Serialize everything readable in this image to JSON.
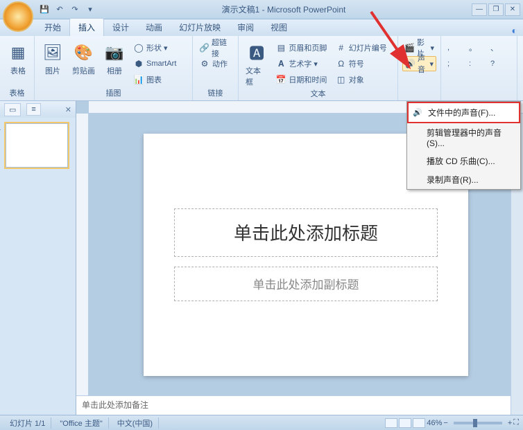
{
  "title": "演示文稿1 - Microsoft PowerPoint",
  "tabs": [
    "开始",
    "插入",
    "设计",
    "动画",
    "幻灯片放映",
    "审阅",
    "视图"
  ],
  "active_tab": 1,
  "ribbon": {
    "g_tables": {
      "label": "表格",
      "table": "表格"
    },
    "g_illust": {
      "label": "插图",
      "pic": "图片",
      "clip": "剪贴画",
      "album": "相册",
      "shapes": "形状",
      "smartart": "SmartArt",
      "chart": "图表"
    },
    "g_links": {
      "label": "链接",
      "hyper": "超链接",
      "action": "动作"
    },
    "g_text": {
      "label": "文本",
      "textbox": "文本框",
      "header": "页眉和页脚",
      "wordart": "艺术字",
      "date": "日期和时间",
      "slidenum": "幻灯片编号",
      "symbol": "符号",
      "object": "对象"
    },
    "g_media": {
      "label": "",
      "movie": "影片",
      "sound": "声音"
    },
    "g_marks": {
      "label": "",
      "m1": ",",
      "m2": "。",
      "m3": "、",
      "m4": ";",
      "m5": ":",
      "m6": "?"
    }
  },
  "dropdown": {
    "file_sound": "文件中的声音(F)...",
    "clip_sound": "剪辑管理器中的声音(S)...",
    "cd": "播放 CD 乐曲(C)...",
    "record": "录制声音(R)..."
  },
  "panel_tabs": {
    "slides_icon": "▭",
    "outline_icon": "≡"
  },
  "slide": {
    "title_ph": "单击此处添加标题",
    "sub_ph": "单击此处添加副标题"
  },
  "notes_ph": "单击此处添加备注",
  "status": {
    "slide": "幻灯片 1/1",
    "theme": "\"Office 主题\"",
    "lang": "中文(中国)",
    "zoom": "46%"
  }
}
